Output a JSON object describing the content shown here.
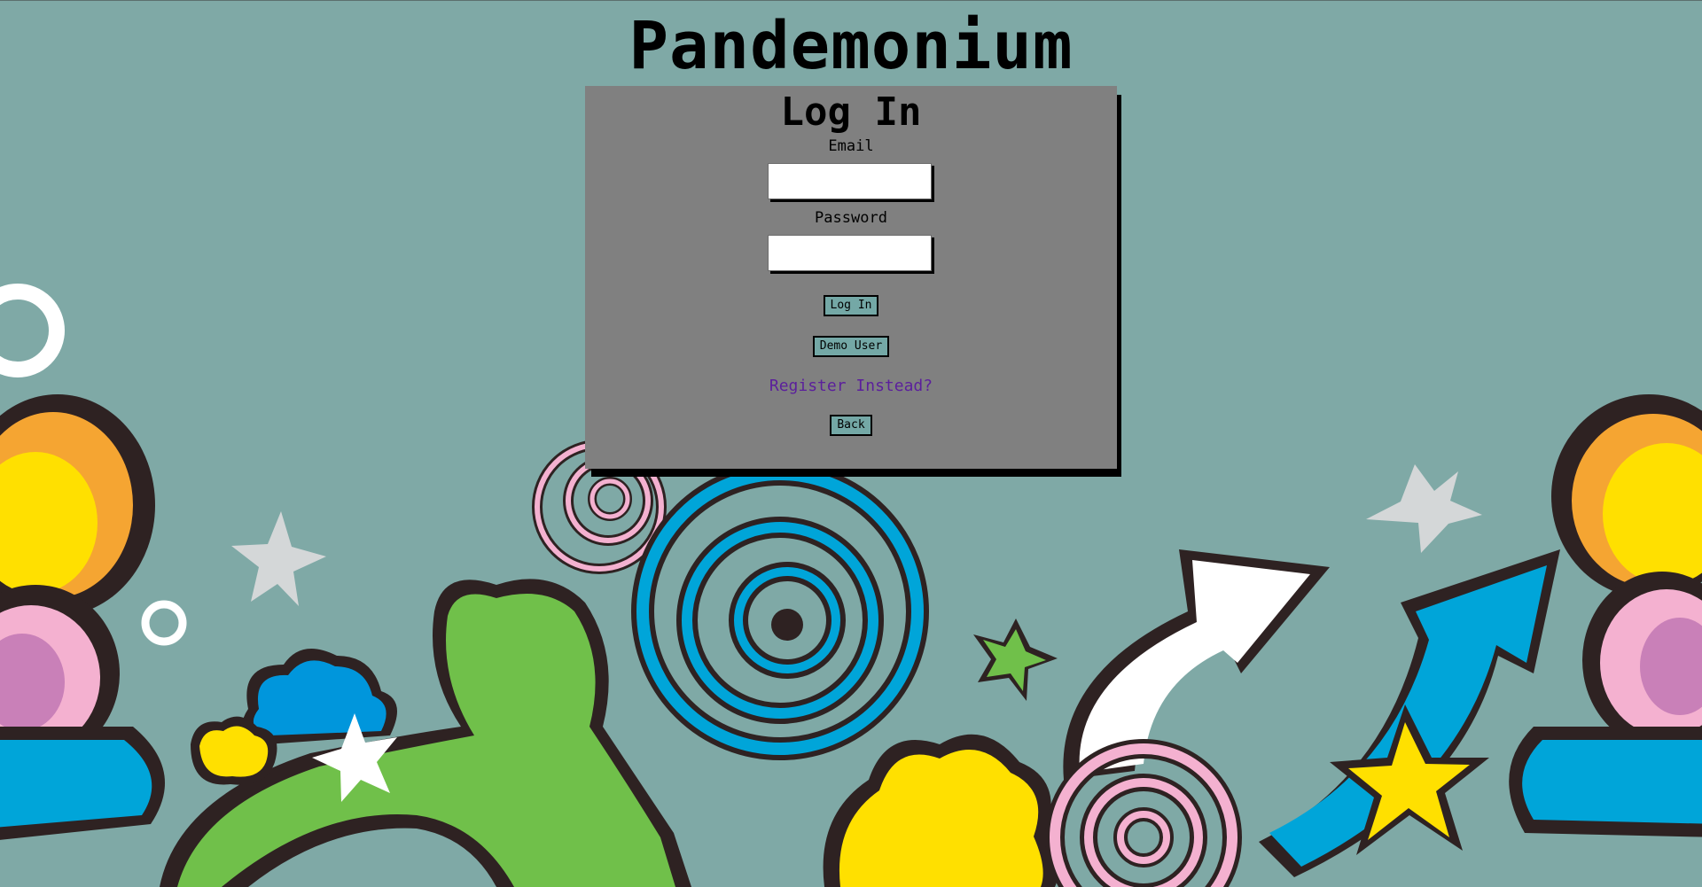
{
  "app": {
    "title": "Pandemonium"
  },
  "login": {
    "heading": "Log In",
    "email_label": "Email",
    "email_value": "",
    "password_label": "Password",
    "password_value": "",
    "login_button": "Log In",
    "demo_button": "Demo User",
    "register_link": "Register Instead?",
    "back_button": "Back"
  },
  "colors": {
    "background": "#7fa9a6",
    "panel": "#808080",
    "button": "#74a8a6",
    "link": "#5b1f9c"
  }
}
